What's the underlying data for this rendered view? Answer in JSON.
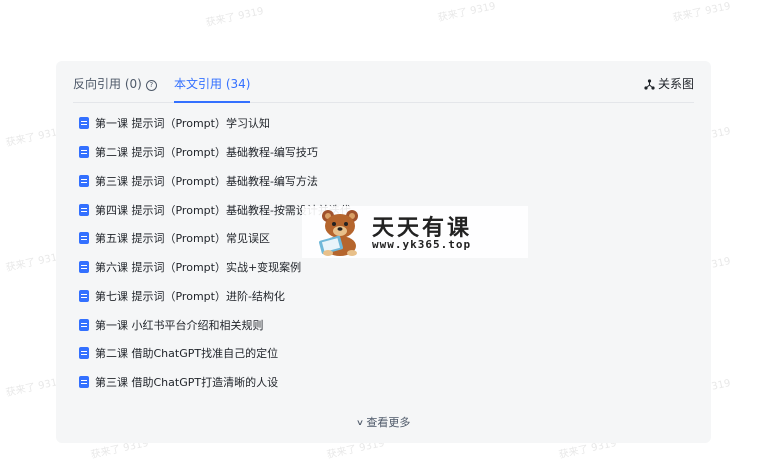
{
  "tabs": {
    "backlinks_label": "反向引用 (0)",
    "backlinks_help": "?",
    "references_label": "本文引用 (34)",
    "graph_label": "关系图"
  },
  "references": [
    "第一课 提示词（Prompt）学习认知",
    "第二课 提示词（Prompt）基础教程-编写技巧",
    "第三课 提示词（Prompt）基础教程-编写方法",
    "第四课 提示词（Prompt）基础教程-按需设计并迭代",
    "第五课 提示词（Prompt）常见误区",
    "第六课 提示词（Prompt）实战+变现案例",
    "第七课 提示词（Prompt）进阶-结构化",
    "第一课 小红书平台介绍和相关规则",
    "第二课 借助ChatGPT找准自己的定位",
    "第三课 借助ChatGPT打造清晰的人设"
  ],
  "more_label": "查看更多",
  "watermark_text": "获来了 9319",
  "logo": {
    "title": "天天有课",
    "url": "www.yk365.top"
  },
  "colors": {
    "accent": "#3370ff",
    "panel_bg": "#f5f6f7"
  }
}
